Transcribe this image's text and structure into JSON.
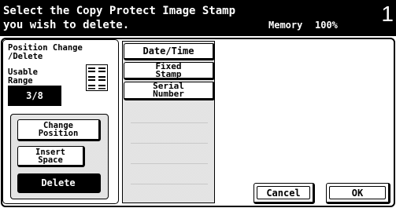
{
  "header": {
    "message_line1": "Select the Copy Protect Image Stamp",
    "message_line2": "you wish to delete.",
    "memory_label": "Memory",
    "memory_value": "100%",
    "page_number": "1"
  },
  "left_panel": {
    "title_line1": "Position Change",
    "title_line2": "/Delete",
    "usable_line1": "Usable",
    "usable_line2": "Range",
    "count": "3/8",
    "icon": "stamp-layout-icon",
    "buttons": {
      "change_position": [
        "Change",
        "Position"
      ],
      "insert_space": [
        "Insert",
        "Space"
      ],
      "delete": "Delete"
    }
  },
  "stamp_list": {
    "date_time": "Date/Time",
    "fixed_stamp": [
      "Fixed",
      "Stamp"
    ],
    "serial_number": [
      "Serial",
      "Number"
    ]
  },
  "actions": {
    "cancel": "Cancel",
    "ok": "OK"
  },
  "colors": {
    "header_bg": "#000000",
    "selected_bg": "#000000",
    "dither": "#9a9a9a"
  }
}
